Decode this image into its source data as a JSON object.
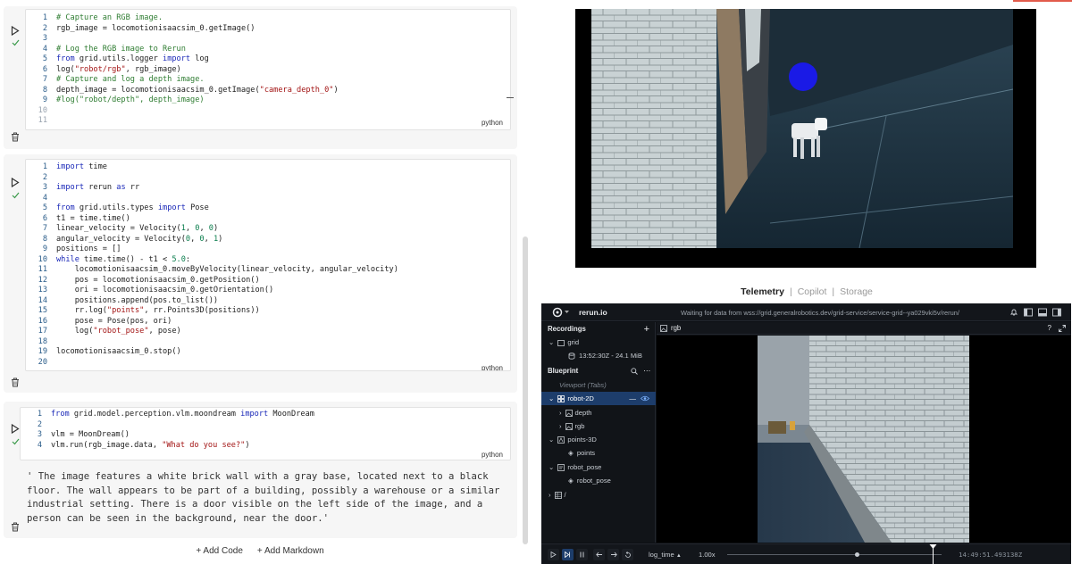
{
  "notebook": {
    "cells": [
      {
        "lines": [
          {
            "n": "1",
            "tokens": [
              [
                "com",
                "# Capture an RGB image."
              ]
            ]
          },
          {
            "n": "2",
            "tokens": [
              [
                "",
                "rgb_image = locomotionisaacsim_0.getImage()"
              ]
            ]
          },
          {
            "n": "3",
            "tokens": []
          },
          {
            "n": "4",
            "tokens": [
              [
                "com",
                "# Log the RGB image to Rerun"
              ]
            ]
          },
          {
            "n": "5",
            "tokens": [
              [
                "kw",
                "from"
              ],
              [
                "",
                " grid.utils.logger "
              ],
              [
                "kw",
                "import"
              ],
              [
                "",
                " log"
              ]
            ]
          },
          {
            "n": "6",
            "tokens": [
              [
                "",
                "log("
              ],
              [
                "str",
                "\"robot/rgb\""
              ],
              [
                "",
                ", rgb_image)"
              ]
            ]
          },
          {
            "n": "7",
            "tokens": [
              [
                "com",
                "# Capture and log a depth image."
              ]
            ]
          },
          {
            "n": "8",
            "tokens": [
              [
                "",
                "depth_image = locomotionisaacsim_0.getImage("
              ],
              [
                "str",
                "\"camera_depth_0\""
              ],
              [
                "",
                ")"
              ]
            ]
          },
          {
            "n": "9",
            "tokens": [
              [
                "com",
                "#log(\"robot/depth\", depth_image)"
              ]
            ]
          },
          {
            "n": "10",
            "tokens": []
          },
          {
            "n": "11",
            "tokens": []
          }
        ],
        "lang": "python",
        "output": ""
      },
      {
        "lines": [
          {
            "n": "1",
            "tokens": [
              [
                "kw",
                "import"
              ],
              [
                "",
                " time"
              ]
            ]
          },
          {
            "n": "2",
            "tokens": []
          },
          {
            "n": "3",
            "tokens": [
              [
                "kw",
                "import"
              ],
              [
                "",
                " rerun "
              ],
              [
                "kw",
                "as"
              ],
              [
                "",
                " rr"
              ]
            ]
          },
          {
            "n": "4",
            "tokens": []
          },
          {
            "n": "5",
            "tokens": [
              [
                "kw",
                "from"
              ],
              [
                "",
                " grid.utils.types "
              ],
              [
                "kw",
                "import"
              ],
              [
                "",
                " Pose"
              ]
            ]
          },
          {
            "n": "6",
            "tokens": [
              [
                "",
                "t1 = time.time()"
              ]
            ]
          },
          {
            "n": "7",
            "tokens": [
              [
                "",
                "linear_velocity = Velocity("
              ],
              [
                "num",
                "1"
              ],
              [
                "",
                ", "
              ],
              [
                "num",
                "0"
              ],
              [
                "",
                ", "
              ],
              [
                "num",
                "0"
              ],
              [
                "",
                ")"
              ]
            ]
          },
          {
            "n": "8",
            "tokens": [
              [
                "",
                "angular_velocity = Velocity("
              ],
              [
                "num",
                "0"
              ],
              [
                "",
                ", "
              ],
              [
                "num",
                "0"
              ],
              [
                "",
                ", "
              ],
              [
                "num",
                "1"
              ],
              [
                "",
                ")"
              ]
            ]
          },
          {
            "n": "9",
            "tokens": [
              [
                "",
                "positions = []"
              ]
            ]
          },
          {
            "n": "10",
            "tokens": [
              [
                "kw",
                "while"
              ],
              [
                "",
                " time.time() - t1 < "
              ],
              [
                "num",
                "5.0"
              ],
              [
                "",
                ":"
              ]
            ]
          },
          {
            "n": "11",
            "tokens": [
              [
                "",
                "    locomotionisaacsim_0.moveByVelocity(linear_velocity, angular_velocity)"
              ]
            ]
          },
          {
            "n": "12",
            "tokens": [
              [
                "",
                "    pos = locomotionisaacsim_0.getPosition()"
              ]
            ]
          },
          {
            "n": "13",
            "tokens": [
              [
                "",
                "    ori = locomotionisaacsim_0.getOrientation()"
              ]
            ]
          },
          {
            "n": "14",
            "tokens": [
              [
                "",
                "    positions.append(pos.to_list())"
              ]
            ]
          },
          {
            "n": "15",
            "tokens": [
              [
                "",
                "    rr.log("
              ],
              [
                "str",
                "\"points\""
              ],
              [
                "",
                ", rr.Points3D(positions))"
              ]
            ]
          },
          {
            "n": "16",
            "tokens": [
              [
                "",
                "    pose = Pose(pos, ori)"
              ]
            ]
          },
          {
            "n": "17",
            "tokens": [
              [
                "",
                "    log("
              ],
              [
                "str",
                "\"robot_pose\""
              ],
              [
                "",
                ", pose)"
              ]
            ]
          },
          {
            "n": "18",
            "tokens": []
          },
          {
            "n": "19",
            "tokens": [
              [
                "",
                "locomotionisaacsim_0.stop()"
              ]
            ]
          },
          {
            "n": "20",
            "tokens": []
          }
        ],
        "lang": "python",
        "output": ""
      },
      {
        "lines": [
          {
            "n": "1",
            "tokens": [
              [
                "kw",
                "from"
              ],
              [
                "",
                " grid.model.perception.vlm.moondream "
              ],
              [
                "kw",
                "import"
              ],
              [
                "",
                " MoonDream"
              ]
            ]
          },
          {
            "n": "2",
            "tokens": []
          },
          {
            "n": "3",
            "tokens": [
              [
                "",
                "vlm = MoonDream()"
              ]
            ]
          },
          {
            "n": "4",
            "tokens": [
              [
                "",
                "vlm.run(rgb_image.data, "
              ],
              [
                "str",
                "\"What do you see?\""
              ],
              [
                "",
                ")"
              ]
            ]
          }
        ],
        "lang": "python",
        "output": "' The image features a white brick wall with a gray base, located next to a black\nfloor. The wall appears to be part of a building, possibly a warehouse or a similar\nindustrial setting. There is a door visible on the left side of the image, and a\nperson can be seen in the background, near the door.'"
      }
    ],
    "add_code": "+ Add Code",
    "add_markdown": "+ Add Markdown"
  },
  "tabs": {
    "telemetry": "Telemetry",
    "copilot": "Copilot",
    "storage": "Storage",
    "sep": "|"
  },
  "rerun": {
    "brand": "rerun.io",
    "status": "Waiting for data from wss://grid.generalrobotics.dev/grid-service/service-grid--ya029vki5v/rerun/",
    "help": "?",
    "view_title": "rgb",
    "recordings_label": "Recordings",
    "add": "+",
    "recording_name": "grid",
    "recording_time": "13:52:30Z - 24.1 MiB",
    "blueprint_label": "Blueprint",
    "more": "⋯",
    "viewport": "Viewport (Tabs)",
    "tree": {
      "robot2d": "robot-2D",
      "depth": "depth",
      "rgb": "rgb",
      "points3d": "points-3D",
      "points": "points",
      "robot_pose_view": "robot_pose",
      "robot_pose": "robot_pose",
      "root": "/"
    },
    "timeline_name": "log_time",
    "speed": "1.00x",
    "time_readout": "14:49:51.493138Z",
    "playhead": 0.96
  },
  "colors": {
    "accent": "#1d3d6b",
    "red_tick": "#e25b4b",
    "keyword": "#1a28b8",
    "string": "#a31515",
    "comment": "#2f7d32"
  }
}
